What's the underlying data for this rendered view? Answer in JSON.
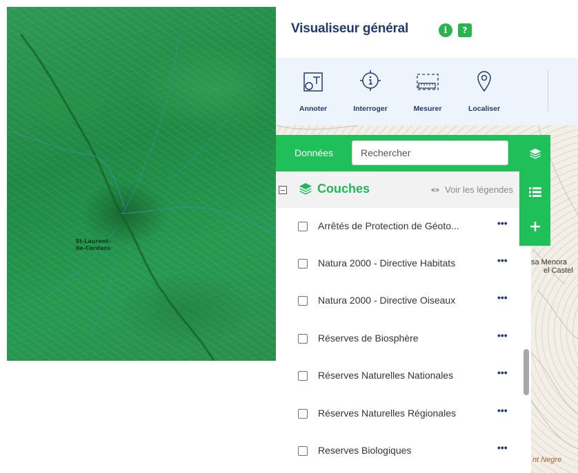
{
  "left_map": {
    "place_label": "St-Laurent-de-Cerdans"
  },
  "right_map": {
    "labels": [
      "sa Menora",
      "el Castel",
      "nt Negre"
    ]
  },
  "header": {
    "title": "Visualiseur général",
    "info_glyph": "i",
    "help_glyph": "?",
    "accent_color": "#2ab34f"
  },
  "toolbar": {
    "tools": [
      {
        "label": "Annoter",
        "icon": "annotate-icon"
      },
      {
        "label": "Interroger",
        "icon": "info-query-icon"
      },
      {
        "label": "Mesurer",
        "icon": "ruler-icon"
      },
      {
        "label": "Localiser",
        "icon": "map-pin-icon"
      }
    ]
  },
  "panel": {
    "label": "Données",
    "search_placeholder": "Rechercher",
    "brand_color": "#1fc05a",
    "layers_title": "Couches",
    "legend_toggle": "Voir les légendes",
    "layers": [
      {
        "name": "Arrêtés de Protection de Géoto...",
        "checked": false
      },
      {
        "name": "Natura 2000 - Directive Habitats",
        "checked": false
      },
      {
        "name": "Natura 2000 - Directive Oiseaux",
        "checked": false
      },
      {
        "name": "Réserves de Biosphère",
        "checked": false
      },
      {
        "name": "Réserves Naturelles Nationales",
        "checked": false
      },
      {
        "name": "Réserves Naturelles Régionales",
        "checked": false
      },
      {
        "name": "Reserves Biologiques",
        "checked": false
      }
    ],
    "more_glyph": "•••"
  },
  "side_rail": {
    "buttons": [
      "layers-icon",
      "list-icon",
      "plus-icon"
    ]
  }
}
